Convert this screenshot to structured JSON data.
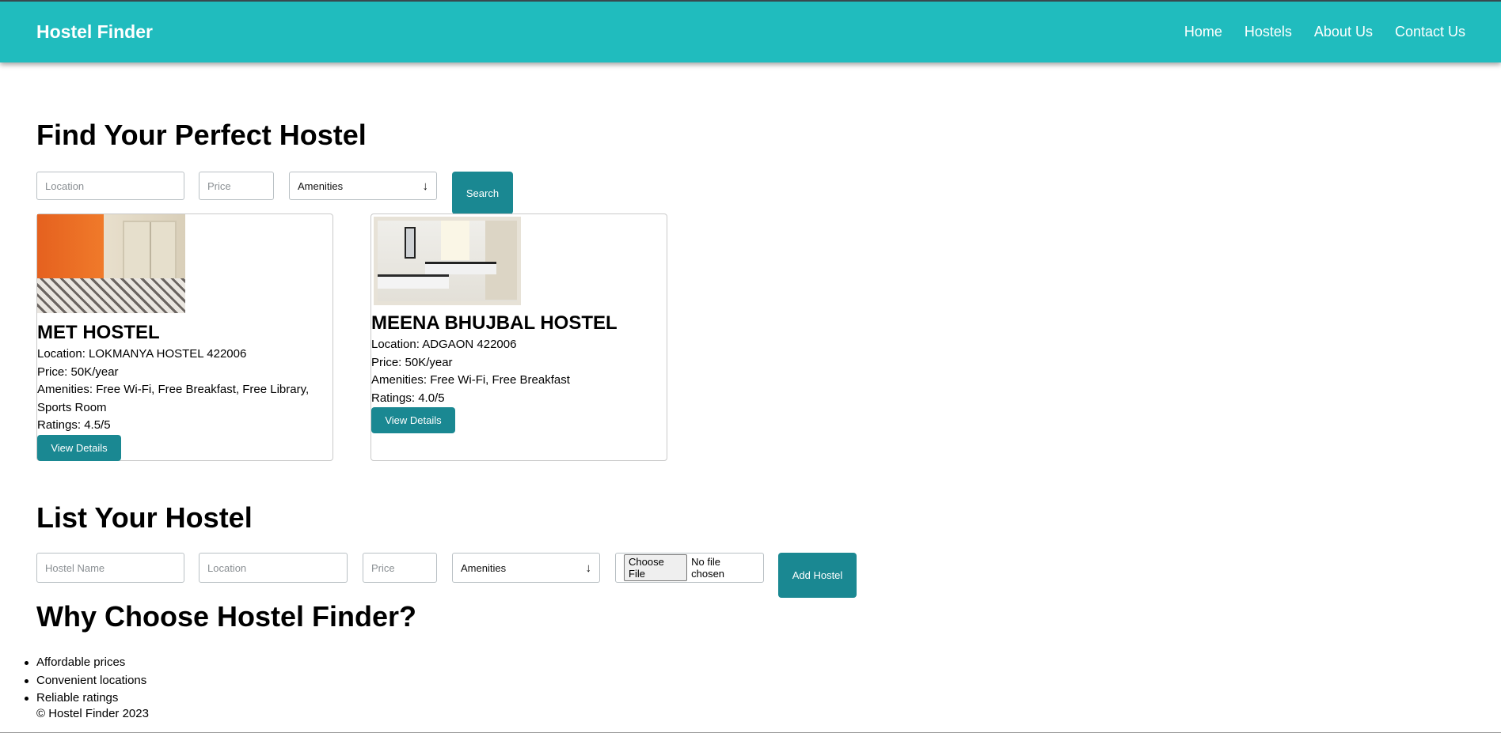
{
  "navbar": {
    "brand": "Hostel Finder",
    "links": [
      "Home",
      "Hostels",
      "About Us",
      "Contact Us"
    ]
  },
  "search": {
    "title": "Find Your Perfect Hostel",
    "location_placeholder": "Location",
    "price_placeholder": "Price",
    "amenities_selected": "Amenities",
    "button_label": "Search"
  },
  "hostels": [
    {
      "name": "MET HOSTEL",
      "location": "Location: LOKMANYA HOSTEL 422006",
      "price": "Price: 50K/year",
      "amenities": "Amenities: Free Wi-Fi, Free Breakfast, Free Library, Sports Room",
      "ratings": "Ratings: 4.5/5",
      "button_label": "View Details"
    },
    {
      "name": "MEENA BHUJBAL HOSTEL",
      "location": "Location: ADGAON 422006",
      "price": "Price: 50K/year",
      "amenities": "Amenities: Free Wi-Fi, Free Breakfast",
      "ratings": "Ratings: 4.0/5",
      "button_label": "View Details"
    }
  ],
  "list_form": {
    "title": "List Your Hostel",
    "name_placeholder": "Hostel Name",
    "location_placeholder": "Location",
    "price_placeholder": "Price",
    "amenities_selected": "Amenities",
    "file_button": "Choose File",
    "file_status": "No file chosen",
    "button_label": "Add Hostel"
  },
  "why": {
    "title": "Why Choose Hostel Finder?",
    "items": [
      "Affordable prices",
      "Convenient locations",
      "Reliable ratings"
    ]
  },
  "footer": {
    "text": "© Hostel Finder 2023"
  },
  "colors": {
    "navbar": "#20bcbe",
    "button": "#1a8892"
  }
}
